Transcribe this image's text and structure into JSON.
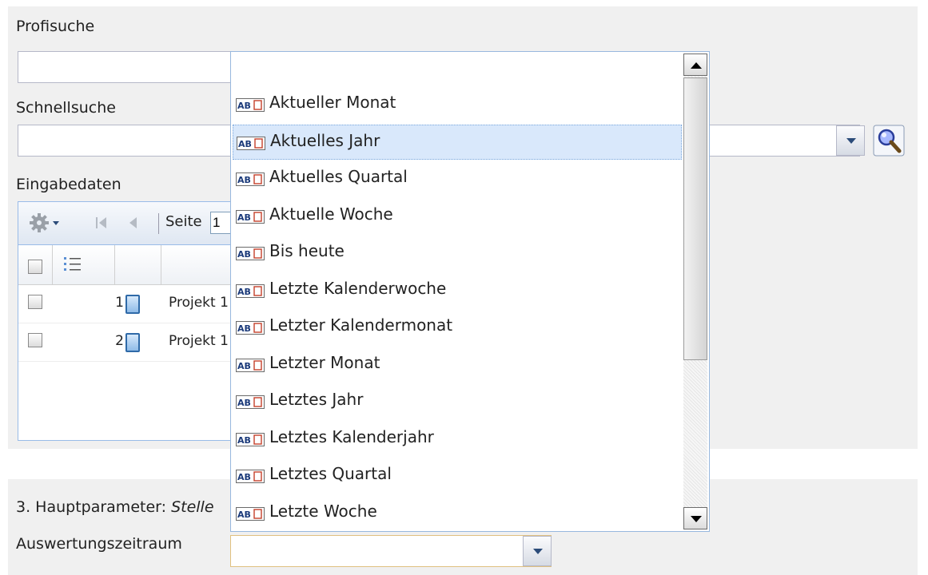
{
  "profisuche": {
    "label": "Profisuche",
    "value": ""
  },
  "schnellsuche": {
    "label": "Schnellsuche",
    "value": ""
  },
  "eingabedaten": {
    "label": "Eingabedaten",
    "toolbar": {
      "page_label": "Seite",
      "page_value": "1"
    },
    "rows": [
      {
        "num": "1",
        "name": "Projekt 1"
      },
      {
        "num": "2",
        "name": "Projekt 1"
      }
    ]
  },
  "hauptparameter": {
    "prefix": "3. Hauptparameter:",
    "name": "Stelle"
  },
  "auswertungszeitraum": {
    "label": "Auswertungszeitraum",
    "value": ""
  },
  "dropdown": {
    "selected_index": 1,
    "items": [
      "Aktueller Monat",
      "Aktuelles Jahr",
      "Aktuelles Quartal",
      "Aktuelle Woche",
      "Bis heute",
      "Letzte Kalenderwoche",
      "Letzter Kalendermonat",
      "Letzter Monat",
      "Letztes Jahr",
      "Letztes Kalenderjahr",
      "Letztes Quartal",
      "Letzte Woche"
    ],
    "item_icon": "text-field-icon"
  },
  "colors": {
    "accent": "#99bbe8",
    "selected": "#d9e8fb",
    "combo_focus": "#e0c080"
  }
}
